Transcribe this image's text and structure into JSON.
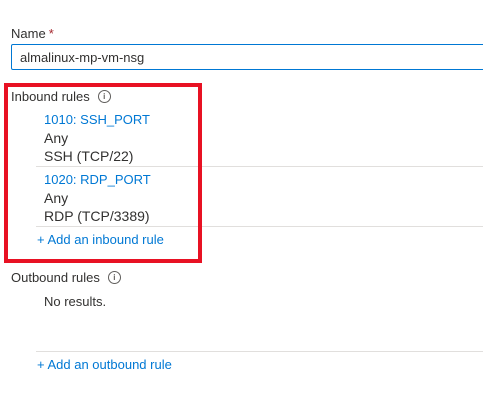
{
  "name_field": {
    "label": "Name",
    "required_marker": "*",
    "value": "almalinux-mp-vm-nsg"
  },
  "inbound": {
    "title": "Inbound rules",
    "info_icon": "info-icon",
    "rules": [
      {
        "name": "1010: SSH_PORT",
        "source": "Any",
        "service": "SSH (TCP/22)"
      },
      {
        "name": "1020: RDP_PORT",
        "source": "Any",
        "service": "RDP (TCP/3389)"
      }
    ],
    "add_label": "+ Add an inbound rule"
  },
  "outbound": {
    "title": "Outbound rules",
    "info_icon": "info-icon",
    "empty_text": "No results.",
    "add_label": "+ Add an outbound rule"
  },
  "colors": {
    "accent": "#0078d4",
    "text": "#323130",
    "required": "#a4262c",
    "highlight": "#e81123",
    "divider": "#e1dfdd"
  }
}
